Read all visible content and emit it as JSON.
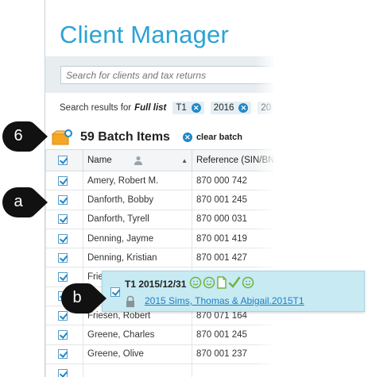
{
  "app": {
    "title": "Client Manager",
    "search": {
      "placeholder": "Search for clients and tax returns"
    },
    "results": {
      "prefix": "Search results for",
      "list_name": "Full list",
      "chips": [
        {
          "label": "T1"
        },
        {
          "label": "2016"
        },
        {
          "label": "20"
        }
      ]
    },
    "batch": {
      "count_label": "59 Batch Items",
      "clear_label": "clear batch"
    },
    "table": {
      "columns": [
        "Name",
        "Reference (SIN/BN"
      ],
      "rows": [
        {
          "name": "Amery, Robert M.",
          "reference": "870 000 742"
        },
        {
          "name": "Danforth, Bobby",
          "reference": "870 001 245"
        },
        {
          "name": "Danforth, Tyrell",
          "reference": "870 000 031"
        },
        {
          "name": "Denning, Jayme",
          "reference": "870 001 419"
        },
        {
          "name": "Denning, Kristian",
          "reference": "870 001 427"
        },
        {
          "name": "Frie",
          "reference": ""
        },
        {
          "name": "",
          "reference": ""
        },
        {
          "name": "Friesen, Robert",
          "reference": "870 071 164"
        },
        {
          "name": "Greene, Charles",
          "reference": "870 001 245"
        },
        {
          "name": "Greene, Olive",
          "reference": "870 001 237"
        },
        {
          "name": "",
          "reference": ""
        }
      ]
    },
    "popup": {
      "title": "T1 2015/12/31",
      "link": "2015 Sims, Thomas & Abigail.2015T1"
    }
  },
  "callouts": [
    {
      "label": "6"
    },
    {
      "label": "a"
    },
    {
      "label": "b"
    }
  ],
  "colors": {
    "accent": "#2aa3d6",
    "chip_x": "#1e88c8",
    "popup_bg": "#c7eaf3",
    "link": "#1c7fc3",
    "status_green": "#6cb43f",
    "callout_bg": "#111111",
    "batch_icon": "#f5a623"
  },
  "icons": {
    "search": "search-icon",
    "batch": "batch-box-icon",
    "clear": "close-circle-icon",
    "person": "person-icon",
    "sort": "sort-ascending-icon",
    "lock": "lock-icon",
    "smiley": "smiley-icon",
    "document": "document-icon",
    "check": "checkmark-icon"
  }
}
